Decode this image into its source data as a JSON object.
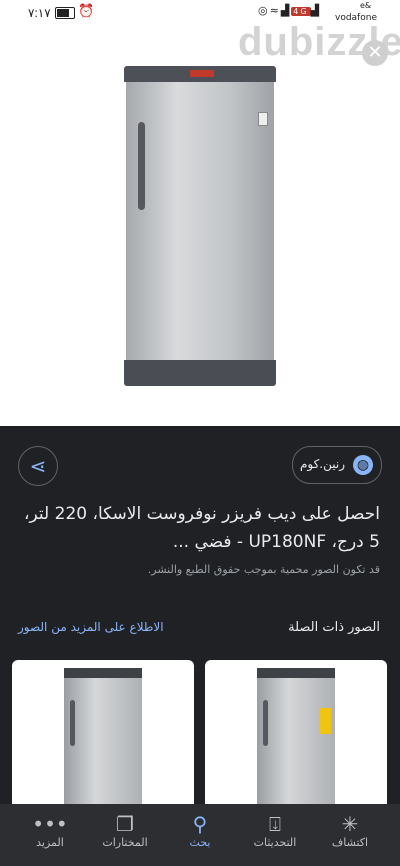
{
  "status_bar": {
    "time": "٧:١٧",
    "carrier": "vodafone",
    "carrier_extra": "e&",
    "network_badge": "4G"
  },
  "hero": {
    "watermark": "dubizzle",
    "close_icon": "close-icon"
  },
  "source": {
    "site_name": "رنين.كوم",
    "globe_icon": "globe-icon",
    "share_icon": "share-icon"
  },
  "result": {
    "title": "احصل على ديب فريزر نوفروست الاسكا، 220 لتر، 5 درج، UP180NF - فضي ...",
    "notice": "قد تكون الصور محمية بموجب حقوق الطبع والنشر."
  },
  "related": {
    "heading": "الصور ذات الصلة",
    "more_link": "الاطلاع على المزيد من الصور"
  },
  "bottom_nav": [
    {
      "label": "اكتشاف",
      "icon": "asterisk-icon"
    },
    {
      "label": "التحديثات",
      "icon": "updates-tray-icon"
    },
    {
      "label": "بحث",
      "icon": "search-icon"
    },
    {
      "label": "المختارات",
      "icon": "bookmarks-icon"
    },
    {
      "label": "المزيد",
      "icon": "more-dots-icon"
    }
  ],
  "colors": {
    "background": "#202124",
    "accent": "#8ab4f8",
    "nav_background": "#2d2e31"
  }
}
